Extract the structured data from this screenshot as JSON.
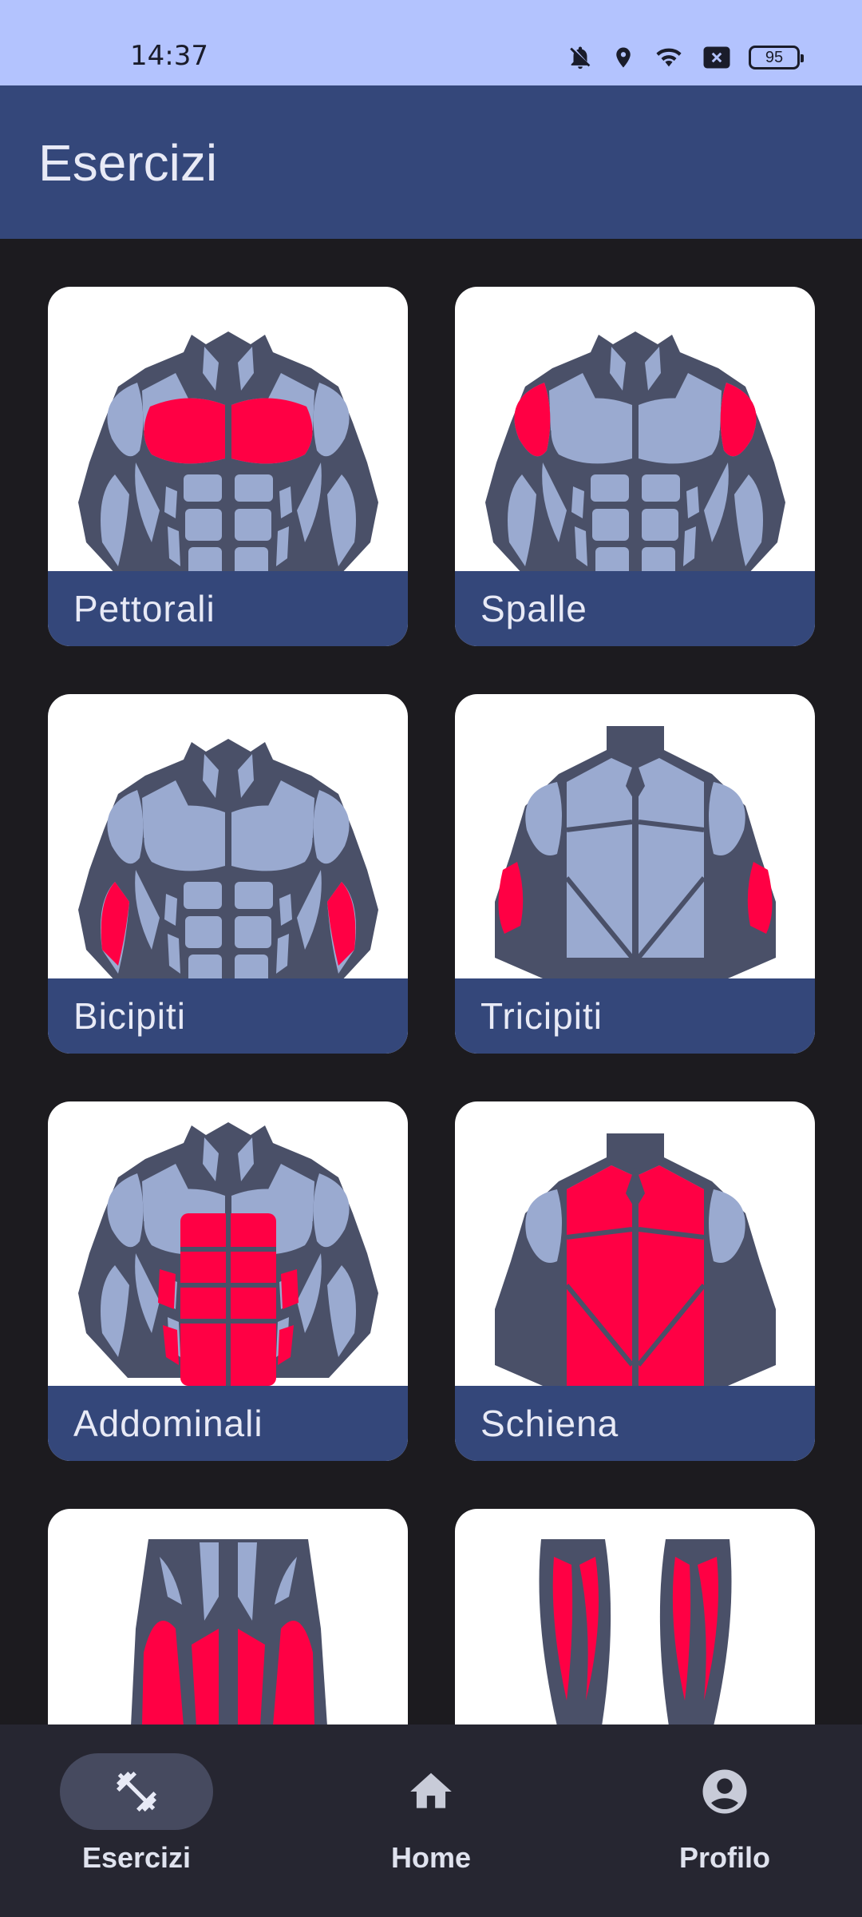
{
  "status_bar": {
    "time": "14:37",
    "battery": "95",
    "icons": [
      "notifications-off-icon",
      "location-icon",
      "wifi-icon",
      "no-sim-icon",
      "battery-icon"
    ]
  },
  "app_bar": {
    "title": "Esercizi"
  },
  "exercises": [
    {
      "label": "Pettorali",
      "icon": "chest-muscles-icon"
    },
    {
      "label": "Spalle",
      "icon": "shoulder-muscles-icon"
    },
    {
      "label": "Bicipiti",
      "icon": "biceps-muscles-icon"
    },
    {
      "label": "Tricipiti",
      "icon": "triceps-muscles-icon"
    },
    {
      "label": "Addominali",
      "icon": "abs-muscles-icon"
    },
    {
      "label": "Schiena",
      "icon": "back-muscles-icon"
    },
    {
      "label": "",
      "icon": "thigh-muscles-icon"
    },
    {
      "label": "",
      "icon": "calf-muscles-icon"
    }
  ],
  "bottom_nav": [
    {
      "label": "Esercizi",
      "icon": "dumbbell-icon",
      "active": true
    },
    {
      "label": "Home",
      "icon": "home-icon",
      "active": false
    },
    {
      "label": "Profilo",
      "icon": "account-circle-icon",
      "active": false
    }
  ],
  "colors": {
    "status_bar": "#b3c3fe",
    "app_bar": "#34477a",
    "background": "#1c1b1f",
    "muscle_highlight": "#ff0044",
    "muscle_base": "#9aaad0",
    "body_outline": "#4a5068",
    "nav_background": "#262631"
  }
}
